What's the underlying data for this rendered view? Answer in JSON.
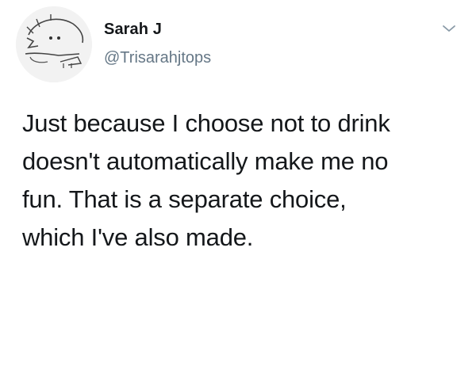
{
  "tweet": {
    "author": {
      "display_name": "Sarah J",
      "handle": "@Trisarahjtops",
      "avatar_icon": "triceratops-sketch-icon"
    },
    "menu_icon": "chevron-down-icon",
    "text_lines": [
      "Just because I choose not to drink",
      "doesn't automatically make me no",
      "fun. That is a separate choice,",
      "which I've also made."
    ]
  },
  "colors": {
    "background": "#ffffff",
    "text_primary": "#14171a",
    "text_secondary": "#657786",
    "chevron": "#8899a6"
  }
}
